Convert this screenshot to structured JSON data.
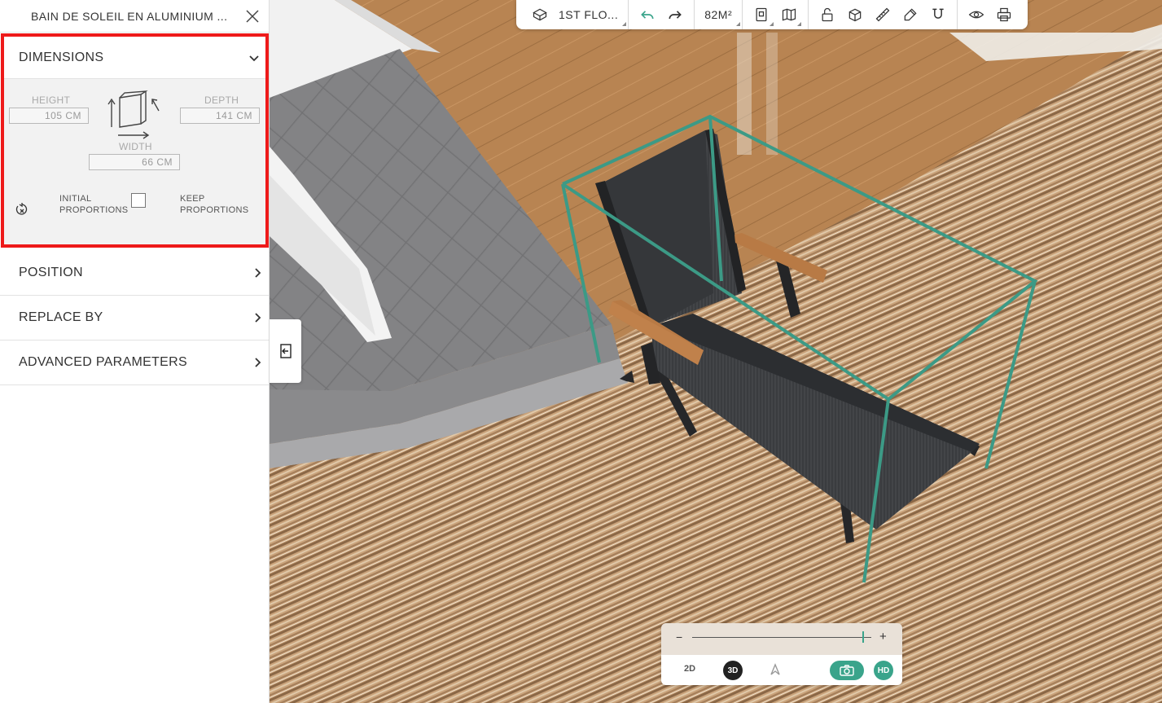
{
  "panel": {
    "title": "BAIN DE SOLEIL EN ALUMINIUM ...",
    "dimensions": {
      "label": "DIMENSIONS",
      "height_label": "HEIGHT",
      "height_value": "105  CM",
      "depth_label": "DEPTH",
      "depth_value": "141  CM",
      "width_label": "WIDTH",
      "width_value": "66  CM",
      "initial_line1": "INITIAL",
      "initial_line2": "PROPORTIONS",
      "keep_line1": "KEEP",
      "keep_line2": "PROPORTIONS"
    },
    "sections": {
      "position": "POSITION",
      "replace_by": "REPLACE BY",
      "advanced": "ADVANCED PARAMETERS"
    }
  },
  "toolbar": {
    "floor": "1ST FLO...",
    "area": "82M²"
  },
  "view_control": {
    "zoom_minus": "−",
    "zoom_plus": "+",
    "zoom_level": 0.95,
    "mode_2d": "2D",
    "mode_3d": "3D",
    "hd": "HD",
    "active_mode": "3D"
  },
  "colors": {
    "selection_frame": "#3c9a86",
    "accent_green": "#3aa48b",
    "highlight_red": "#ee1a1a",
    "deck_wood": "#c79a63",
    "tile_gray": "#7d7d7f"
  }
}
